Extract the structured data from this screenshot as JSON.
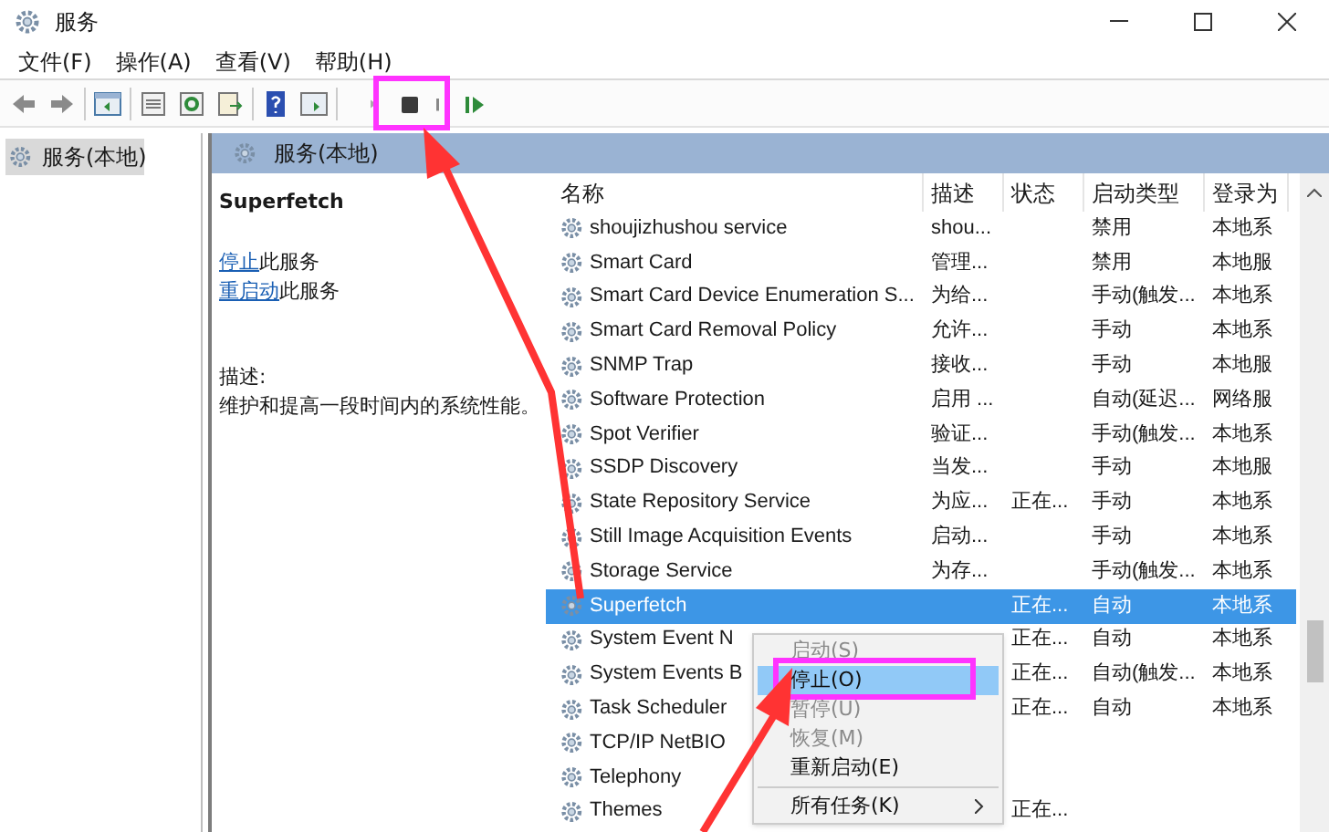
{
  "window": {
    "title": "服务"
  },
  "menu": [
    "文件(F)",
    "操作(A)",
    "查看(V)",
    "帮助(H)"
  ],
  "tree": [
    {
      "label": "服务(本地)",
      "selected": true
    }
  ],
  "header": {
    "title": "服务(本地)"
  },
  "details": {
    "service_name": "Superfetch",
    "actions": [
      {
        "link": "停止",
        "text": "此服务"
      },
      {
        "link": "重启动",
        "text": "此服务"
      }
    ],
    "description_label": "描述:",
    "description": "维护和提高一段时间内的系统性能。"
  },
  "table": {
    "columns": [
      "名称",
      "描述",
      "状态",
      "启动类型",
      "登录为"
    ],
    "rows": [
      {
        "name": "shoujizhushou service",
        "description": "shou...",
        "status": "",
        "startup": "禁用",
        "logon": "本地系",
        "selected": false
      },
      {
        "name": "Smart Card",
        "description": "管理...",
        "status": "",
        "startup": "禁用",
        "logon": "本地服",
        "selected": false
      },
      {
        "name": "Smart Card Device Enumeration S...",
        "description": "为给...",
        "status": "",
        "startup": "手动(触发...",
        "logon": "本地系",
        "selected": false
      },
      {
        "name": "Smart Card Removal Policy",
        "description": "允许...",
        "status": "",
        "startup": "手动",
        "logon": "本地系",
        "selected": false
      },
      {
        "name": "SNMP Trap",
        "description": "接收...",
        "status": "",
        "startup": "手动",
        "logon": "本地服",
        "selected": false
      },
      {
        "name": "Software Protection",
        "description": "启用 ...",
        "status": "",
        "startup": "自动(延迟...",
        "logon": "网络服",
        "selected": false
      },
      {
        "name": "Spot Verifier",
        "description": "验证...",
        "status": "",
        "startup": "手动(触发...",
        "logon": "本地系",
        "selected": false
      },
      {
        "name": "SSDP Discovery",
        "description": "当发...",
        "status": "",
        "startup": "手动",
        "logon": "本地服",
        "selected": false
      },
      {
        "name": "State Repository Service",
        "description": "为应...",
        "status": "正在...",
        "startup": "手动",
        "logon": "本地系",
        "selected": false
      },
      {
        "name": "Still Image Acquisition Events",
        "description": "启动...",
        "status": "",
        "startup": "手动",
        "logon": "本地系",
        "selected": false
      },
      {
        "name": "Storage Service",
        "description": "为存...",
        "status": "",
        "startup": "手动(触发...",
        "logon": "本地系",
        "selected": false
      },
      {
        "name": "Superfetch",
        "description": "",
        "status": "正在...",
        "startup": "自动",
        "logon": "本地系",
        "selected": true
      },
      {
        "name": "System Event N",
        "description": "",
        "status": "正在...",
        "startup": "自动",
        "logon": "本地系",
        "selected": false
      },
      {
        "name": "System Events B",
        "description": "",
        "status": "正在...",
        "startup": "自动(触发...",
        "logon": "本地系",
        "selected": false
      },
      {
        "name": "Task Scheduler",
        "description": "",
        "status": "正在...",
        "startup": "自动",
        "logon": "本地系",
        "selected": false
      },
      {
        "name": "TCP/IP NetBIO",
        "description": "",
        "status": "",
        "startup": "",
        "logon": "",
        "selected": false
      },
      {
        "name": "Telephony",
        "description": "",
        "status": "",
        "startup": "",
        "logon": "",
        "selected": false
      },
      {
        "name": "Themes",
        "description": "",
        "status": "正在...",
        "startup": "",
        "logon": "",
        "selected": false
      }
    ]
  },
  "context_menu": [
    {
      "label": "启动(S)",
      "disabled": true,
      "selected": false,
      "kind": "item"
    },
    {
      "label": "停止(O)",
      "disabled": false,
      "selected": true,
      "kind": "item"
    },
    {
      "label": "暂停(U)",
      "disabled": true,
      "selected": false,
      "kind": "item"
    },
    {
      "label": "恢复(M)",
      "disabled": true,
      "selected": false,
      "kind": "item"
    },
    {
      "label": "重新启动(E)",
      "disabled": false,
      "selected": false,
      "kind": "item"
    },
    {
      "label": "所有任务(K)",
      "disabled": false,
      "selected": false,
      "kind": "submenu"
    }
  ]
}
